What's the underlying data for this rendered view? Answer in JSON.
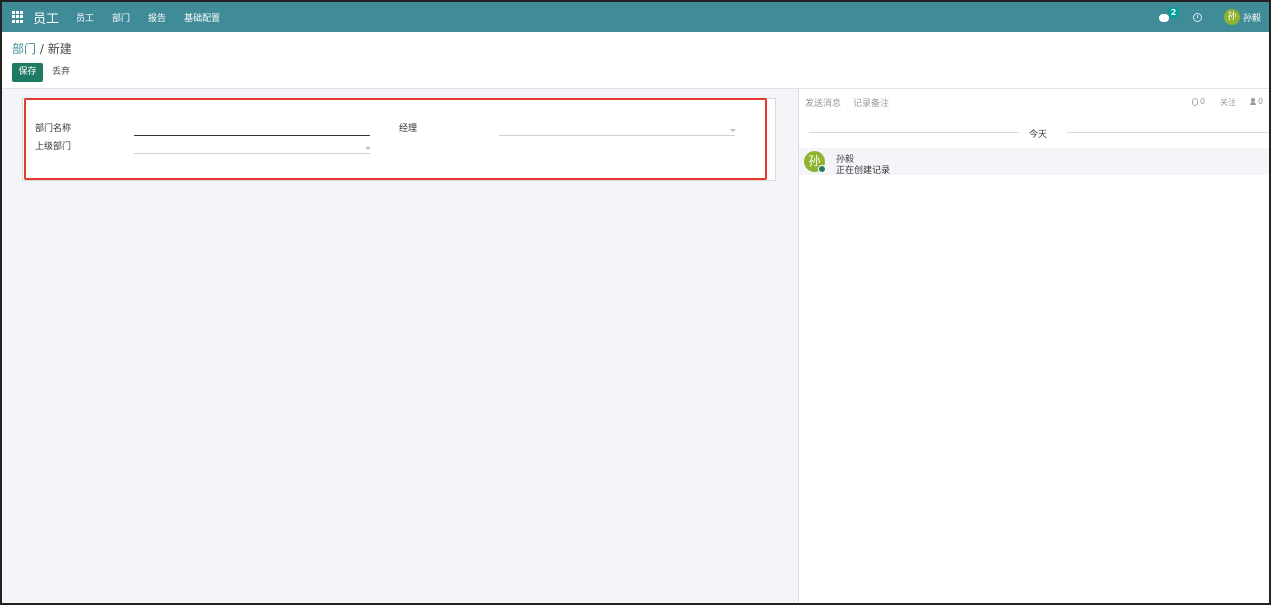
{
  "navbar": {
    "app_title": "员工",
    "menu": [
      "员工",
      "部门",
      "报告",
      "基础配置"
    ],
    "message_count": "2",
    "user_initial": "孙",
    "user_name": "孙毅"
  },
  "breadcrumb": {
    "parent": "部门",
    "separator": " / ",
    "current": "新建"
  },
  "buttons": {
    "save": "保存",
    "discard": "丢弃"
  },
  "form": {
    "dept_name_label": "部门名称",
    "parent_dept_label": "上级部门",
    "manager_label": "经理",
    "dept_name_value": "",
    "parent_dept_value": "",
    "manager_value": ""
  },
  "chatter": {
    "send_message": "发送消息",
    "log_note": "记录备注",
    "attachments_count": "0",
    "follow": "关注",
    "followers_count": "0",
    "day_label": "今天",
    "message": {
      "author_initial": "孙",
      "author": "孙毅",
      "body": "正在创建记录"
    }
  },
  "colors": {
    "navbar": "#3f8b98",
    "primary_button": "#1f7a63",
    "highlight_border": "#e53b2f",
    "avatar": "#8fb32f"
  }
}
